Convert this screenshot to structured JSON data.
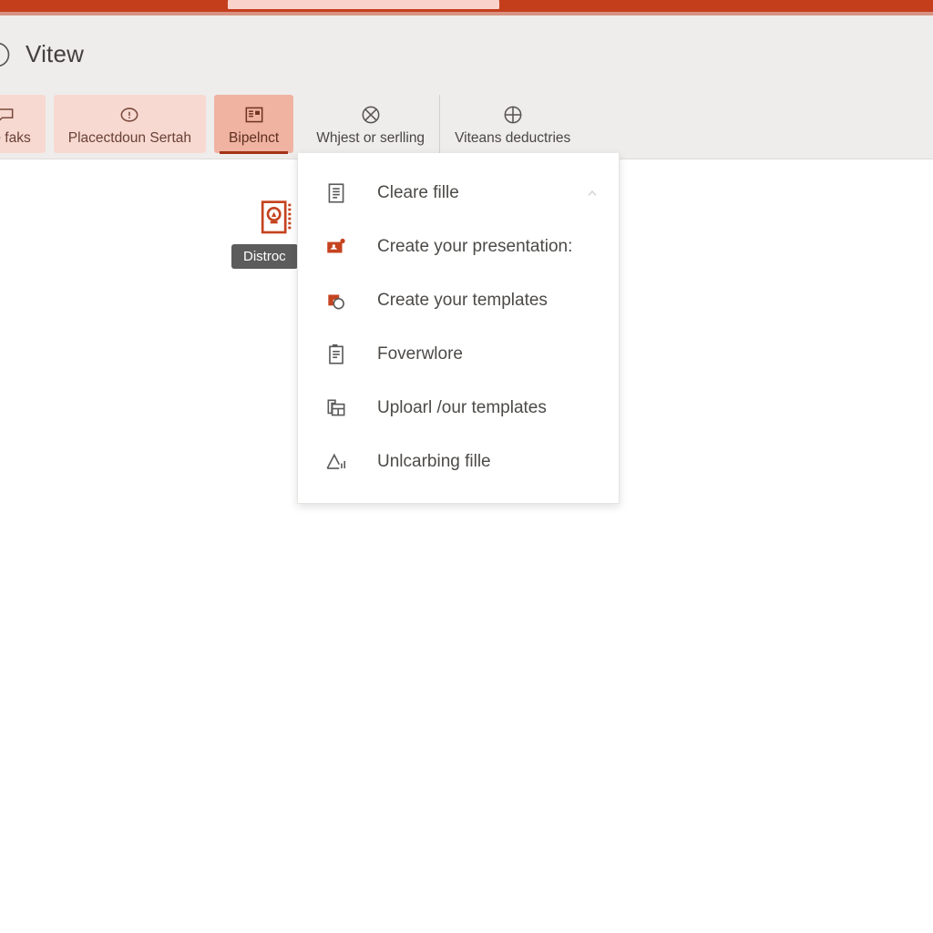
{
  "titlebar": {
    "brand_color": "#c43e1c",
    "field_color": "#f9d2cb"
  },
  "header": {
    "title": "Vitew",
    "icon": "info-circle-icon",
    "band_color": "#eeedeb"
  },
  "tabs": [
    {
      "label": "Life faks",
      "icon": "speech-bubble-icon",
      "style": "chip",
      "active": false,
      "separator": false
    },
    {
      "label": "Placectdoun Sertah",
      "icon": "info-circle-icon",
      "style": "chip",
      "active": false,
      "separator": false
    },
    {
      "label": "Bipelnct",
      "icon": "slide-layout-icon",
      "style": "chip",
      "active": true,
      "separator": false
    },
    {
      "label": "Whjest or serlling",
      "icon": "no-entry-slash-icon",
      "style": "plain",
      "active": false,
      "separator": false
    },
    {
      "label": "Viteans deductries",
      "icon": "crosshair-plus-icon",
      "style": "plain",
      "active": false,
      "separator": true
    }
  ],
  "canvas": {
    "item_icon": "presentation-idea-icon",
    "tooltip": "Distroc"
  },
  "menu": {
    "items": [
      {
        "label": "Cleare fille",
        "icon": "document-lines-icon",
        "icon_color": "#5a5a5a",
        "caret": true
      },
      {
        "label": "Create your presentation:",
        "icon": "new-presentation-icon",
        "icon_color": "#c5431f",
        "caret": false
      },
      {
        "label": "Create your templates",
        "icon": "template-circle-icon",
        "icon_color": "#c5431f",
        "caret": false
      },
      {
        "label": "Foverwlore",
        "icon": "clipboard-doc-icon",
        "icon_color": "#5a5a5a",
        "caret": false
      },
      {
        "label": "Uploarl /our templates",
        "icon": "upload-copy-icon",
        "icon_color": "#5a5a5a",
        "caret": false
      },
      {
        "label": "Unlcarbing fille",
        "icon": "chart-triangle-icon",
        "icon_color": "#5a5a5a",
        "caret": false
      }
    ]
  }
}
